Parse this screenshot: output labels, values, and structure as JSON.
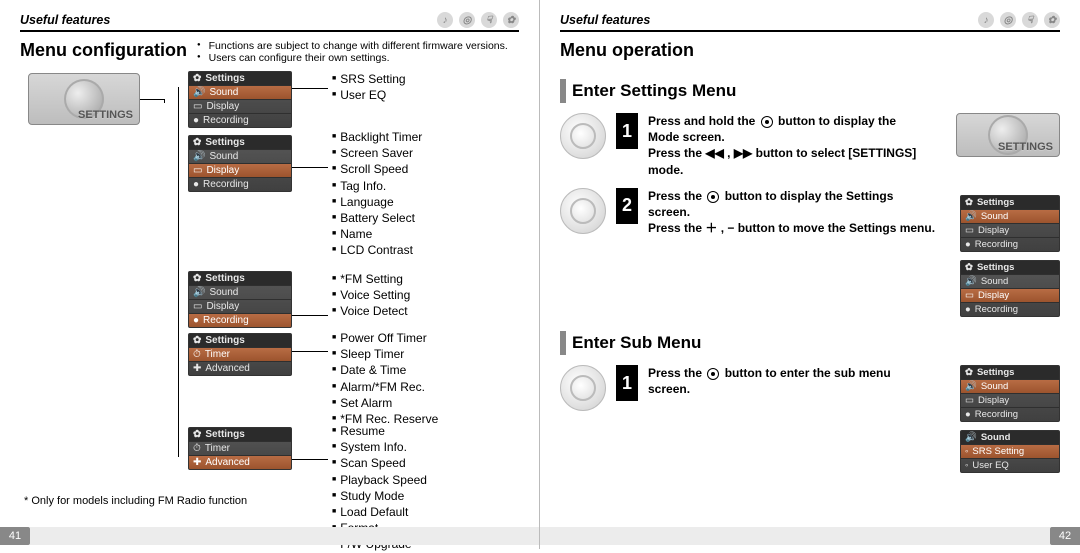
{
  "left": {
    "section": "Useful features",
    "title": "Menu configuration",
    "notes": [
      "Functions are subject to change with different firmware versions.",
      "Users can configure their own settings."
    ],
    "settings_badge": "SETTINGS",
    "cards": {
      "sound": [
        "Settings",
        "Sound",
        "Display",
        "Recording"
      ],
      "display": [
        "Settings",
        "Sound",
        "Display",
        "Recording"
      ],
      "recording": [
        "Settings",
        "Sound",
        "Display",
        "Recording"
      ],
      "timer": [
        "Settings",
        "Timer",
        "Advanced"
      ],
      "advanced": [
        "Settings",
        "Timer",
        "Advanced"
      ]
    },
    "lists": {
      "sound": [
        "SRS Setting",
        "User EQ"
      ],
      "display": [
        "Backlight Timer",
        "Screen Saver",
        "Scroll Speed",
        "Tag Info.",
        "Language",
        "Battery Select",
        "Name",
        "LCD Contrast"
      ],
      "recording": [
        "*FM Setting",
        "Voice Setting",
        "Voice Detect"
      ],
      "timer": [
        "Power Off Timer",
        "Sleep Timer",
        "Date & Time",
        "Alarm/*FM Rec.",
        "Set Alarm",
        "*FM Rec. Reserve"
      ],
      "advanced": [
        "Resume",
        "System Info.",
        "Scan Speed",
        "Playback Speed",
        "Study Mode",
        "Load Default",
        "Format",
        "F/W Upgrade"
      ]
    },
    "footnote": "* Only for models including FM Radio function",
    "page_num": "41"
  },
  "right": {
    "section": "Useful features",
    "title": "Menu operation",
    "settings_badge": "SETTINGS",
    "heading_settings": "Enter Settings Menu",
    "heading_submenu": "Enter Sub Menu",
    "steps_settings": [
      {
        "num": "1",
        "line1a": "Press and hold the ",
        "line1b": " button to display the",
        "line1c": "Mode screen.",
        "line2": "Press the  ◀◀ , ▶▶  button to select [SETTINGS] mode."
      },
      {
        "num": "2",
        "line1a": "Press the ",
        "line1b": " button to display the Settings",
        "line1c": "screen.",
        "line2": "Press the  ＋ ,  −  button to move the Settings menu."
      }
    ],
    "steps_submenu": [
      {
        "num": "1",
        "line1a": "Press the ",
        "line1b": " button to enter the sub menu",
        "line1c": "screen."
      }
    ],
    "cards": {
      "step2a": [
        "Settings",
        "Sound",
        "Display",
        "Recording"
      ],
      "step2b": [
        "Settings",
        "Sound",
        "Display",
        "Recording"
      ],
      "sub_a": [
        "Settings",
        "Sound",
        "Display",
        "Recording"
      ],
      "sub_b": [
        "Sound",
        "SRS Setting",
        "User EQ"
      ]
    },
    "page_num": "42"
  }
}
